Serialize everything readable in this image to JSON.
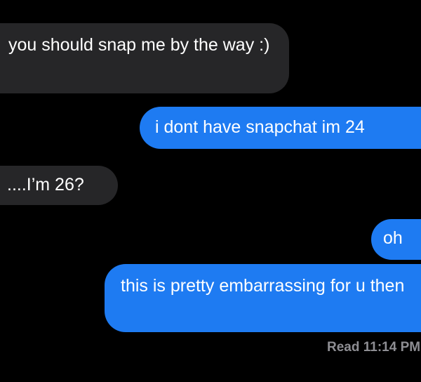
{
  "messages": [
    {
      "direction": "received",
      "text": "you should snap me by the way :)"
    },
    {
      "direction": "sent",
      "text": "i dont have snapchat im 24"
    },
    {
      "direction": "received",
      "text": "....I’m 26?"
    },
    {
      "direction": "sent",
      "text": "oh"
    },
    {
      "direction": "sent",
      "text": "this is pretty embarrassing for u then"
    }
  ],
  "read_receipt": "Read 11:14 PM",
  "colors": {
    "background": "#000000",
    "received_bubble": "#262628",
    "sent_bubble": "#1e7bf2",
    "receipt_text": "#8e8e93"
  }
}
